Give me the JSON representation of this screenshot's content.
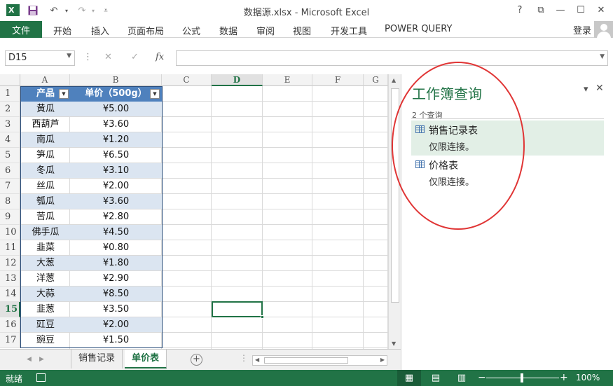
{
  "window": {
    "title": "数据源.xlsx - Microsoft Excel",
    "help": "?",
    "restore": "⧉",
    "minimize": "—",
    "maximize": "☐",
    "close": "✕",
    "excel_logo": "X"
  },
  "quick_access": {
    "save_icon": "save-icon",
    "undo": "↶",
    "redo": "↷",
    "customize": "⩡"
  },
  "ribbon": {
    "file": "文件",
    "tabs": [
      "开始",
      "插入",
      "页面布局",
      "公式",
      "数据",
      "审阅",
      "视图",
      "开发工具",
      "POWER QUERY"
    ],
    "login": "登录"
  },
  "formula_bar": {
    "name_box": "D15",
    "cancel": "✕",
    "enter": "✓",
    "fx": "fx",
    "formula": ""
  },
  "sheet": {
    "columns": [
      "A",
      "B",
      "C",
      "D",
      "E",
      "F",
      "G"
    ],
    "rows": [
      "1",
      "2",
      "3",
      "4",
      "5",
      "6",
      "7",
      "8",
      "9",
      "10",
      "11",
      "12",
      "13",
      "14",
      "15",
      "16",
      "17"
    ],
    "header": {
      "product": "产品",
      "price": "单价（500g）"
    },
    "data": [
      [
        "黄瓜",
        "¥5.00"
      ],
      [
        "西葫芦",
        "¥3.60"
      ],
      [
        "南瓜",
        "¥1.20"
      ],
      [
        "笋瓜",
        "¥6.50"
      ],
      [
        "冬瓜",
        "¥3.10"
      ],
      [
        "丝瓜",
        "¥2.00"
      ],
      [
        "瓠瓜",
        "¥3.60"
      ],
      [
        "苦瓜",
        "¥2.80"
      ],
      [
        "佛手瓜",
        "¥4.50"
      ],
      [
        "韭菜",
        "¥0.80"
      ],
      [
        "大葱",
        "¥1.80"
      ],
      [
        "洋葱",
        "¥2.90"
      ],
      [
        "大蒜",
        "¥8.50"
      ],
      [
        "韭葱",
        "¥3.50"
      ],
      [
        "豇豆",
        "¥2.00"
      ],
      [
        "豌豆",
        "¥1.50"
      ]
    ],
    "selected_col": "D",
    "selected_row": "15"
  },
  "sheet_tabs": {
    "tabs": [
      "销售记录",
      "单价表"
    ],
    "active": "单价表",
    "add": "+",
    "more": "⋮"
  },
  "query_pane": {
    "title": "工作簿查询",
    "count": "2 个查询",
    "queries": [
      {
        "name": "销售记录表",
        "status": "仅限连接。"
      },
      {
        "name": "价格表",
        "status": "仅限连接。"
      }
    ],
    "dropdown": "▾",
    "close": "✕"
  },
  "status_bar": {
    "ready": "就绪",
    "zoom": "100%",
    "zoom_out": "−",
    "zoom_in": "+"
  },
  "colors": {
    "accent": "#217346",
    "table_header": "#4f81bd",
    "band": "#dbe5f1",
    "annotation": "#e03535"
  }
}
